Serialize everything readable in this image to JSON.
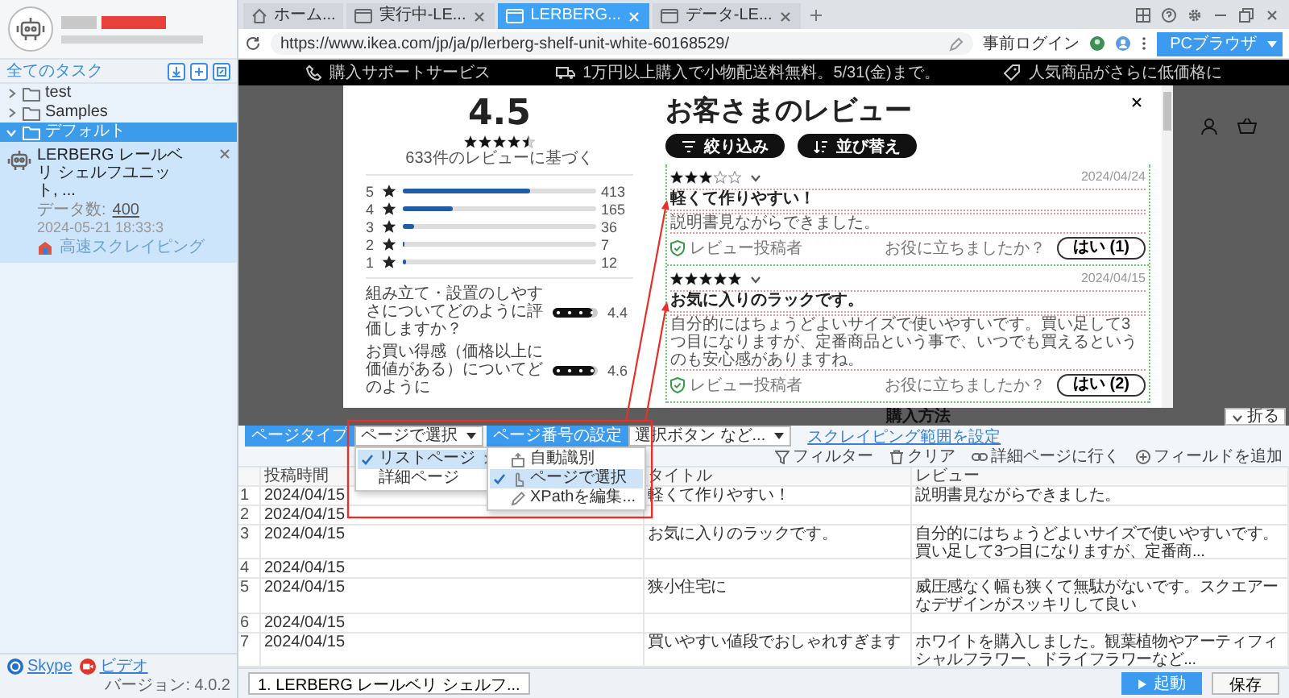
{
  "sidebar": {
    "all_tasks": "全てのタスク",
    "folders": [
      {
        "label": "test",
        "expanded": false,
        "selected": false
      },
      {
        "label": "Samples",
        "expanded": false,
        "selected": false
      },
      {
        "label": "デフォルト",
        "expanded": true,
        "selected": true,
        "children": [
          {
            "title": "LERBERG レールベリ シェルフユニット, ...",
            "count_label": "データ数:",
            "count": "400",
            "time": "2024-05-21 18:33:3",
            "mode": "高速スクレイピング"
          }
        ]
      }
    ],
    "links": [
      {
        "kind": "skype",
        "label": "Skype"
      },
      {
        "kind": "video",
        "label": "ビデオ"
      }
    ],
    "version": "バージョン: 4.0.2"
  },
  "browser": {
    "tabs": [
      {
        "kind": "home",
        "label": "ホーム...",
        "selected": false
      },
      {
        "kind": "page",
        "label": "実行中-LE...",
        "selected": false
      },
      {
        "kind": "page",
        "label": "LERBERG...",
        "selected": true
      },
      {
        "kind": "page",
        "label": "データ-LE...",
        "selected": false
      }
    ],
    "url": "https://www.ikea.com/jp/ja/p/lerberg-shelf-unit-white-60168529/",
    "login": "事前ログイン",
    "mode": "PCブラウザ"
  },
  "page": {
    "banner": [
      {
        "kind": "phone",
        "text": "購入サポートサービス"
      },
      {
        "kind": "truck",
        "text": "1万円以上購入で小物配送料無料。5/31(金)まで。"
      },
      {
        "kind": "tag",
        "text": "人気商品がさらに低価格に"
      }
    ],
    "heading": "購入方法"
  },
  "reviews_modal": {
    "rating": "4.5",
    "stars": 4.5,
    "basis": "633件のレビューに基づく",
    "distribution": [
      {
        "label": "5",
        "level": 0.66,
        "count": "413"
      },
      {
        "label": "4",
        "level": 0.26,
        "count": "165"
      },
      {
        "label": "3",
        "level": 0.06,
        "count": "36"
      },
      {
        "label": "2",
        "level": 0.01,
        "count": "7"
      },
      {
        "label": "1",
        "level": 0.02,
        "count": "12"
      }
    ],
    "questions": [
      {
        "text": "組み立て・設置のしやすさについてどのように評価しますか？",
        "level": 0.88,
        "score": "4.4"
      },
      {
        "text": "お買い得感（価格以上に価値がある）についてどのように",
        "level": 0.92,
        "score": "4.6"
      }
    ],
    "title": "お客さまのレビュー",
    "buttons": [
      {
        "kind": "filter",
        "label": "絞り込み"
      },
      {
        "kind": "sort",
        "label": "並び替え"
      }
    ],
    "reviews": [
      {
        "stars": 3,
        "date": "2024/04/24",
        "title": "軽くて作りやすい！",
        "body": "説明書見ながらできました。",
        "author": "レビュー投稿者",
        "helpful": "お役に立ちましたか？",
        "yes": "はい (1)"
      },
      {
        "stars": 5,
        "date": "2024/04/15",
        "title": "お気に入りのラックです。",
        "body": "自分的にはちょうどよいサイズで使いやすいです。買い足して3つ目になりますが、定番商品という事で、いつでも買えるというのも安心感がありますね。",
        "author": "レビュー投稿者",
        "helpful": "お役に立ちましたか？",
        "yes": "はい (2)"
      }
    ]
  },
  "scraper": {
    "fold": "折る",
    "page_type_label": "ページタイプ",
    "page_type_value": "ページで選択",
    "page_number_label": "ページ番号の設定",
    "page_number_value": "選択ボタン など...",
    "range_link": "スクレイピング範囲を設定",
    "actions": [
      {
        "kind": "filter",
        "label": "フィルター"
      },
      {
        "kind": "trash",
        "label": "クリア"
      },
      {
        "kind": "link",
        "label": "詳細ページに行く"
      },
      {
        "kind": "add",
        "label": "フィールドを追加"
      }
    ],
    "page_type_menu": [
      {
        "label": "リストページ",
        "selected": true,
        "submenu": true
      },
      {
        "label": "詳細ページ",
        "selected": false,
        "submenu": false
      }
    ],
    "selection_menu": [
      {
        "kind": "auto",
        "label": "自動識別",
        "selected": false
      },
      {
        "kind": "pick",
        "label": "ページで選択",
        "selected": true
      },
      {
        "kind": "xpath",
        "label": "XPathを編集...",
        "selected": false
      }
    ],
    "columns": [
      "投稿時間",
      "タイトル",
      "レビュー"
    ],
    "rows": [
      {
        "index": "1",
        "time": "2024/04/15",
        "title": "軽くて作りやすい！",
        "review": "説明書見ながらできました。"
      },
      {
        "index": "2",
        "time": "2024/04/15"
      },
      {
        "index": "3",
        "time": "2024/04/15",
        "title": "お気に入りのラックです。",
        "review": "自分的にはちょうどよいサイズで使いやすいです。買い足して3つ目になりますが、定番商..."
      },
      {
        "index": "4",
        "time": "2024/04/15"
      },
      {
        "index": "5",
        "time": "2024/04/15",
        "title": "狭小住宅に",
        "review": "威圧感なく幅も狭くて無駄がないです。スクエアーなデザインがスッキリして良い"
      },
      {
        "index": "6",
        "time": "2024/04/15"
      },
      {
        "index": "7",
        "time": "2024/04/15",
        "title": "買いやすい値段でおしゃれすぎます",
        "review": "ホワイトを購入しました。観葉植物やアーティフィシャルフラワー、ドライフラワーなど..."
      }
    ],
    "task_tab": "1. LERBERG レールベリ シェルフ...",
    "start": "起動",
    "save": "保存"
  }
}
